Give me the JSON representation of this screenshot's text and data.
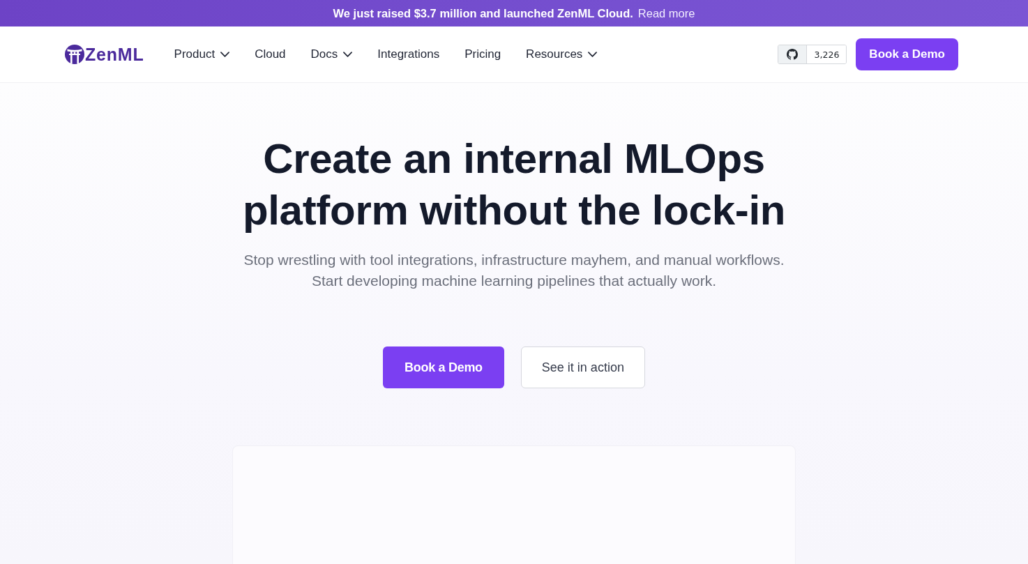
{
  "announcement": {
    "text": "We just raised $3.7 million and launched ZenML Cloud.",
    "link": "Read more"
  },
  "header": {
    "logo": "ZenML",
    "nav": [
      {
        "label": "Product",
        "has_menu": true
      },
      {
        "label": "Cloud",
        "has_menu": false
      },
      {
        "label": "Docs",
        "has_menu": true
      },
      {
        "label": "Integrations",
        "has_menu": false
      },
      {
        "label": "Pricing",
        "has_menu": false
      },
      {
        "label": "Resources",
        "has_menu": true
      }
    ],
    "github": {
      "stars": "3,226"
    },
    "cta": "Book a Demo"
  },
  "hero": {
    "title": "Create an internal MLOps platform without the lock-in",
    "subtitle": "Stop wrestling with tool integrations, infrastructure mayhem, and manual workflows. Start developing machine learning pipelines that actually work.",
    "buttons": [
      {
        "label": "Book a Demo",
        "kind": "primary"
      },
      {
        "label": "See it in action",
        "kind": "secondary"
      }
    ]
  }
}
